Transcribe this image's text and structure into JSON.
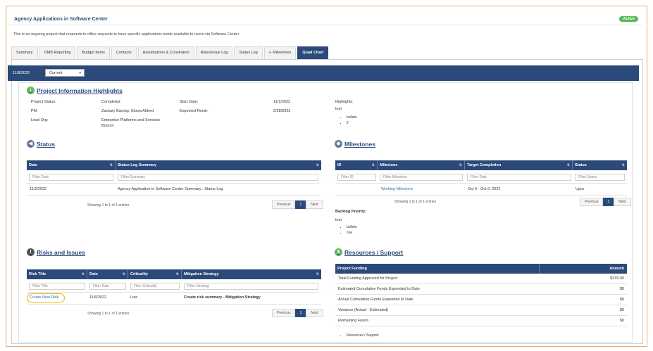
{
  "header": {
    "title": "Agency Applications in Software Center",
    "status_badge": "Active",
    "description": "This is an ongoing project that responds to office requests to have specific applications made available to users via Software Center."
  },
  "tabs": [
    {
      "label": "Summary"
    },
    {
      "label": "OMB Reporting"
    },
    {
      "label": "Budget Items"
    },
    {
      "label": "Contacts"
    },
    {
      "label": "Assumptions & Constraints"
    },
    {
      "label": "Risks/Issue Log"
    },
    {
      "label": "Status Log"
    },
    {
      "label": "Milestones"
    },
    {
      "label": "Quad Chart"
    }
  ],
  "toolbar": {
    "date": "11/9/2022",
    "select_value": "Current"
  },
  "project_info": {
    "title": "Project Information Highlights",
    "project_status_label": "Project Status:",
    "project_status_value": "Completed",
    "pm_label": "PM:",
    "pm_value": "Zackary Barclay, Eloisa Aldred",
    "lead_org_label": "Lead Org:",
    "lead_org_value_1": "Enterprise Platforms and Services",
    "lead_org_value_2": "Branch",
    "start_date_label": "Start Date:",
    "start_date_value": "11/1/2022",
    "expected_finish_label": "Expected Finish:",
    "expected_finish_value": "2/28/2023",
    "highlights_label": "Highlights:",
    "highlights_text": "test",
    "highlights_bullets": [
      "bullets",
      "2"
    ]
  },
  "status": {
    "title": "Status",
    "columns": [
      "Date",
      "Status Log Summary"
    ],
    "filters": [
      "Filter Date",
      "Filter Summary"
    ],
    "rows": [
      [
        "11/2/2022",
        "Agency Application in Software Center Summary : Status Log"
      ]
    ],
    "info": "Showing 1 to 1 of 1 entries",
    "pager": {
      "prev": "Previous",
      "page": "1",
      "next": "Next"
    }
  },
  "milestones": {
    "title": "Milestones",
    "columns": [
      "ID",
      "Milestone",
      "Target Completion",
      "Status"
    ],
    "filters": [
      "Filter ID",
      "Filter Milestone",
      "Filter Date",
      "Filter Status"
    ],
    "rows": [
      [
        "",
        "Working Milestone",
        "Oct 6 - Oct 6, 2022",
        "Upcs"
      ]
    ],
    "info": "Showing 1 to 1 of 1 entries",
    "pager": {
      "prev": "Previous",
      "page": "1",
      "next": "Next"
    },
    "backlog_label": "Backlog Priority:",
    "backlog_text": "test",
    "backlog_bullets": [
      "bullets",
      "one"
    ]
  },
  "risks": {
    "title": "Risks and Issues",
    "columns": [
      "Risk Title",
      "Date",
      "Criticality",
      "Mitigation Strategy"
    ],
    "filters": [
      "Filter Title",
      "Filter Date",
      "Filter Criticality",
      "Filter Strategy"
    ],
    "rows": [
      [
        "Create New Risk",
        "11/6/2022",
        "Low",
        "Create risk summary - Mitigation Strategy"
      ]
    ],
    "info": "Showing 1 to 1 of 1 entries",
    "pager": {
      "prev": "Previous",
      "page": "1",
      "next": "Next"
    }
  },
  "resources": {
    "title": "Resources / Support",
    "columns": [
      "Project Funding",
      "Amount"
    ],
    "rows": [
      [
        "Total Funding Approved for Project",
        "$233.00"
      ],
      [
        "Estimated Cumulative Funds Expended to Date",
        "$0"
      ],
      [
        "Actual Cumulative Funds Expended to Date",
        "$0"
      ],
      [
        "Variance (Actual - Estimated)",
        "$0"
      ],
      [
        "Remaining Funds",
        "$0"
      ]
    ],
    "footer_bullet": "Resources / Support"
  },
  "colors": {
    "brand_navy": "#2b4a7a",
    "active_green": "#5cb85c",
    "frame_orange": "#e8a76a",
    "highlight_yellow": "#f0b400"
  },
  "icons": {
    "project_info": "info-icon",
    "status": "status-icon",
    "milestones": "milestone-icon",
    "risks": "alert-icon",
    "resources": "dollar-icon"
  }
}
